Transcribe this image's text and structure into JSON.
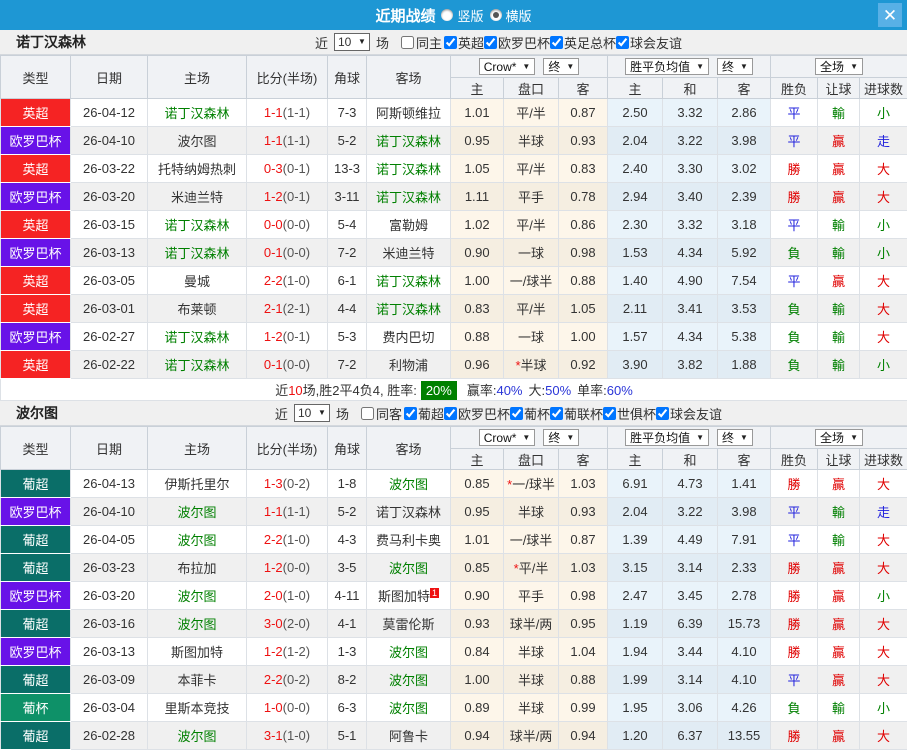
{
  "titlebar": {
    "title": "近期战绩",
    "radio_vertical": "竖版",
    "radio_horizontal": "横版",
    "close": "✕",
    "bar_color": "#1e97d4"
  },
  "filters": {
    "near": "近",
    "count": "10",
    "games": "场"
  },
  "table_header": {
    "cols": [
      "类型",
      "日期",
      "主场",
      "比分(半场)",
      "角球",
      "客场"
    ],
    "dropdowns": [
      "Crow*",
      "终",
      "胜平负均值",
      "终",
      "全场"
    ],
    "sub": [
      "主",
      "盘口",
      "客",
      "主",
      "和",
      "客",
      "胜负",
      "让球",
      "进球数"
    ]
  },
  "league_colors": {
    "英超": "#f52323",
    "欧罗巴杯": "#6812e8",
    "葡超": "#0a6e68",
    "葡杯": "#0e9168"
  },
  "result_colors": {
    "勝": "#e00000",
    "贏": "#e00000",
    "大": "#e00000",
    "平": "#2222dd",
    "走": "#2222dd",
    "負": "#008000",
    "輸": "#008000",
    "小": "#008000"
  },
  "sections": [
    {
      "team": "诺丁汉森林",
      "same_label": "同主",
      "same_checked": false,
      "leagues": [
        "英超",
        "欧罗巴杯",
        "英足总杯",
        "球会友谊"
      ],
      "rows": [
        {
          "league": "英超",
          "date": "26-04-12",
          "home": "诺丁汉森林",
          "score": "1-1",
          "half": "(1-1)",
          "corner": "7-3",
          "away": "阿斯顿维拉",
          "o1": "1.01",
          "hcp": "平/半",
          "o2": "0.87",
          "w": "2.50",
          "d": "3.32",
          "l": "2.86",
          "r1": "平",
          "r2": "輸",
          "r3": "小"
        },
        {
          "league": "欧罗巴杯",
          "date": "26-04-10",
          "home": "波尔图",
          "score": "1-1",
          "half": "(1-1)",
          "corner": "5-2",
          "away": "诺丁汉森林",
          "o1": "0.95",
          "hcp": "半球",
          "o2": "0.93",
          "w": "2.04",
          "d": "3.22",
          "l": "3.98",
          "r1": "平",
          "r2": "贏",
          "r3": "走"
        },
        {
          "league": "英超",
          "date": "26-03-22",
          "home": "托特纳姆热刺",
          "score": "0-3",
          "half": "(0-1)",
          "corner": "13-3",
          "away": "诺丁汉森林",
          "o1": "1.05",
          "hcp": "平/半",
          "o2": "0.83",
          "w": "2.40",
          "d": "3.30",
          "l": "3.02",
          "r1": "勝",
          "r2": "贏",
          "r3": "大"
        },
        {
          "league": "欧罗巴杯",
          "date": "26-03-20",
          "home": "米迪兰特",
          "score": "1-2",
          "half": "(0-1)",
          "corner": "3-11",
          "away": "诺丁汉森林",
          "o1": "1.11",
          "hcp": "平手",
          "o2": "0.78",
          "w": "2.94",
          "d": "3.40",
          "l": "2.39",
          "r1": "勝",
          "r2": "贏",
          "r3": "大"
        },
        {
          "league": "英超",
          "date": "26-03-15",
          "home": "诺丁汉森林",
          "score": "0-0",
          "half": "(0-0)",
          "corner": "5-4",
          "away": "富勒姆",
          "o1": "1.02",
          "hcp": "平/半",
          "o2": "0.86",
          "w": "2.30",
          "d": "3.32",
          "l": "3.18",
          "r1": "平",
          "r2": "輸",
          "r3": "小"
        },
        {
          "league": "欧罗巴杯",
          "date": "26-03-13",
          "home": "诺丁汉森林",
          "score": "0-1",
          "half": "(0-0)",
          "corner": "7-2",
          "away": "米迪兰特",
          "o1": "0.90",
          "hcp": "一球",
          "o2": "0.98",
          "w": "1.53",
          "d": "4.34",
          "l": "5.92",
          "r1": "負",
          "r2": "輸",
          "r3": "小"
        },
        {
          "league": "英超",
          "date": "26-03-05",
          "home": "曼城",
          "score": "2-2",
          "half": "(1-0)",
          "corner": "6-1",
          "away": "诺丁汉森林",
          "o1": "1.00",
          "hcp": "一/球半",
          "o2": "0.88",
          "w": "1.40",
          "d": "4.90",
          "l": "7.54",
          "r1": "平",
          "r2": "贏",
          "r3": "大"
        },
        {
          "league": "英超",
          "date": "26-03-01",
          "home": "布莱顿",
          "score": "2-1",
          "half": "(2-1)",
          "corner": "4-4",
          "away": "诺丁汉森林",
          "o1": "0.83",
          "hcp": "平/半",
          "o2": "1.05",
          "w": "2.11",
          "d": "3.41",
          "l": "3.53",
          "r1": "負",
          "r2": "輸",
          "r3": "大"
        },
        {
          "league": "欧罗巴杯",
          "date": "26-02-27",
          "home": "诺丁汉森林",
          "score": "1-2",
          "half": "(0-1)",
          "corner": "5-3",
          "away": "费内巴切",
          "o1": "0.88",
          "hcp": "一球",
          "o2": "1.00",
          "w": "1.57",
          "d": "4.34",
          "l": "5.38",
          "r1": "負",
          "r2": "輸",
          "r3": "大"
        },
        {
          "league": "英超",
          "date": "26-02-22",
          "home": "诺丁汉森林",
          "score": "0-1",
          "half": "(0-0)",
          "corner": "7-2",
          "away": "利物浦",
          "o1": "0.96",
          "hcp": "*半球",
          "o2": "0.92",
          "w": "3.90",
          "d": "3.82",
          "l": "1.88",
          "r1": "負",
          "r2": "輸",
          "r3": "小"
        }
      ],
      "summary": {
        "part1": "近",
        "n": "10",
        "part2": "场,胜2平4负4, 胜率:",
        "rate": "20%",
        "l1": "赢率:",
        "v1": "40%",
        "l2": "大:",
        "v2": "50%",
        "l3": "单率:",
        "v3": "60%"
      }
    },
    {
      "team": "波尔图",
      "same_label": "同客",
      "same_checked": false,
      "leagues": [
        "葡超",
        "欧罗巴杯",
        "葡杯",
        "葡联杯",
        "世俱杯",
        "球会友谊"
      ],
      "rows": [
        {
          "league": "葡超",
          "date": "26-04-13",
          "home": "伊斯托里尔",
          "score": "1-3",
          "half": "(0-2)",
          "corner": "1-8",
          "away": "波尔图",
          "o1": "0.85",
          "hcp": "*一/球半",
          "o2": "1.03",
          "w": "6.91",
          "d": "4.73",
          "l": "1.41",
          "r1": "勝",
          "r2": "贏",
          "r3": "大"
        },
        {
          "league": "欧罗巴杯",
          "date": "26-04-10",
          "home": "波尔图",
          "score": "1-1",
          "half": "(1-1)",
          "corner": "5-2",
          "away": "诺丁汉森林",
          "o1": "0.95",
          "hcp": "半球",
          "o2": "0.93",
          "w": "2.04",
          "d": "3.22",
          "l": "3.98",
          "r1": "平",
          "r2": "輸",
          "r3": "走"
        },
        {
          "league": "葡超",
          "date": "26-04-05",
          "home": "波尔图",
          "score": "2-2",
          "half": "(1-0)",
          "corner": "4-3",
          "away": "费马利卡奥",
          "o1": "1.01",
          "hcp": "一/球半",
          "o2": "0.87",
          "w": "1.39",
          "d": "4.49",
          "l": "7.91",
          "r1": "平",
          "r2": "輸",
          "r3": "大"
        },
        {
          "league": "葡超",
          "date": "26-03-23",
          "home": "布拉加",
          "score": "1-2",
          "half": "(0-0)",
          "corner": "3-5",
          "away": "波尔图",
          "o1": "0.85",
          "hcp": "*平/半",
          "o2": "1.03",
          "w": "3.15",
          "d": "3.14",
          "l": "2.33",
          "r1": "勝",
          "r2": "贏",
          "r3": "大"
        },
        {
          "league": "欧罗巴杯",
          "date": "26-03-20",
          "home": "波尔图",
          "score": "2-0",
          "half": "(1-0)",
          "corner": "4-11",
          "away": "斯图加特",
          "away_sup": "1",
          "o1": "0.90",
          "hcp": "平手",
          "o2": "0.98",
          "w": "2.47",
          "d": "3.45",
          "l": "2.78",
          "r1": "勝",
          "r2": "贏",
          "r3": "小"
        },
        {
          "league": "葡超",
          "date": "26-03-16",
          "home": "波尔图",
          "score": "3-0",
          "half": "(2-0)",
          "corner": "4-1",
          "away": "莫雷伦斯",
          "o1": "0.93",
          "hcp": "球半/两",
          "o2": "0.95",
          "w": "1.19",
          "d": "6.39",
          "l": "15.73",
          "r1": "勝",
          "r2": "贏",
          "r3": "大"
        },
        {
          "league": "欧罗巴杯",
          "date": "26-03-13",
          "home": "斯图加特",
          "score": "1-2",
          "half": "(1-2)",
          "corner": "1-3",
          "away": "波尔图",
          "o1": "0.84",
          "hcp": "半球",
          "o2": "1.04",
          "w": "1.94",
          "d": "3.44",
          "l": "4.10",
          "r1": "勝",
          "r2": "贏",
          "r3": "大"
        },
        {
          "league": "葡超",
          "date": "26-03-09",
          "home": "本菲卡",
          "score": "2-2",
          "half": "(0-2)",
          "corner": "8-2",
          "away": "波尔图",
          "o1": "1.00",
          "hcp": "半球",
          "o2": "0.88",
          "w": "1.99",
          "d": "3.14",
          "l": "4.10",
          "r1": "平",
          "r2": "贏",
          "r3": "大"
        },
        {
          "league": "葡杯",
          "date": "26-03-04",
          "home": "里斯本竞技",
          "score": "1-0",
          "half": "(0-0)",
          "corner": "6-3",
          "away": "波尔图",
          "o1": "0.89",
          "hcp": "半球",
          "o2": "0.99",
          "w": "1.95",
          "d": "3.06",
          "l": "4.26",
          "r1": "負",
          "r2": "輸",
          "r3": "小"
        },
        {
          "league": "葡超",
          "date": "26-02-28",
          "home": "波尔图",
          "score": "3-1",
          "half": "(1-0)",
          "corner": "5-1",
          "away": "阿鲁卡",
          "o1": "0.94",
          "hcp": "球半/两",
          "o2": "0.94",
          "w": "1.20",
          "d": "6.37",
          "l": "13.55",
          "r1": "勝",
          "r2": "贏",
          "r3": "大"
        }
      ]
    }
  ]
}
